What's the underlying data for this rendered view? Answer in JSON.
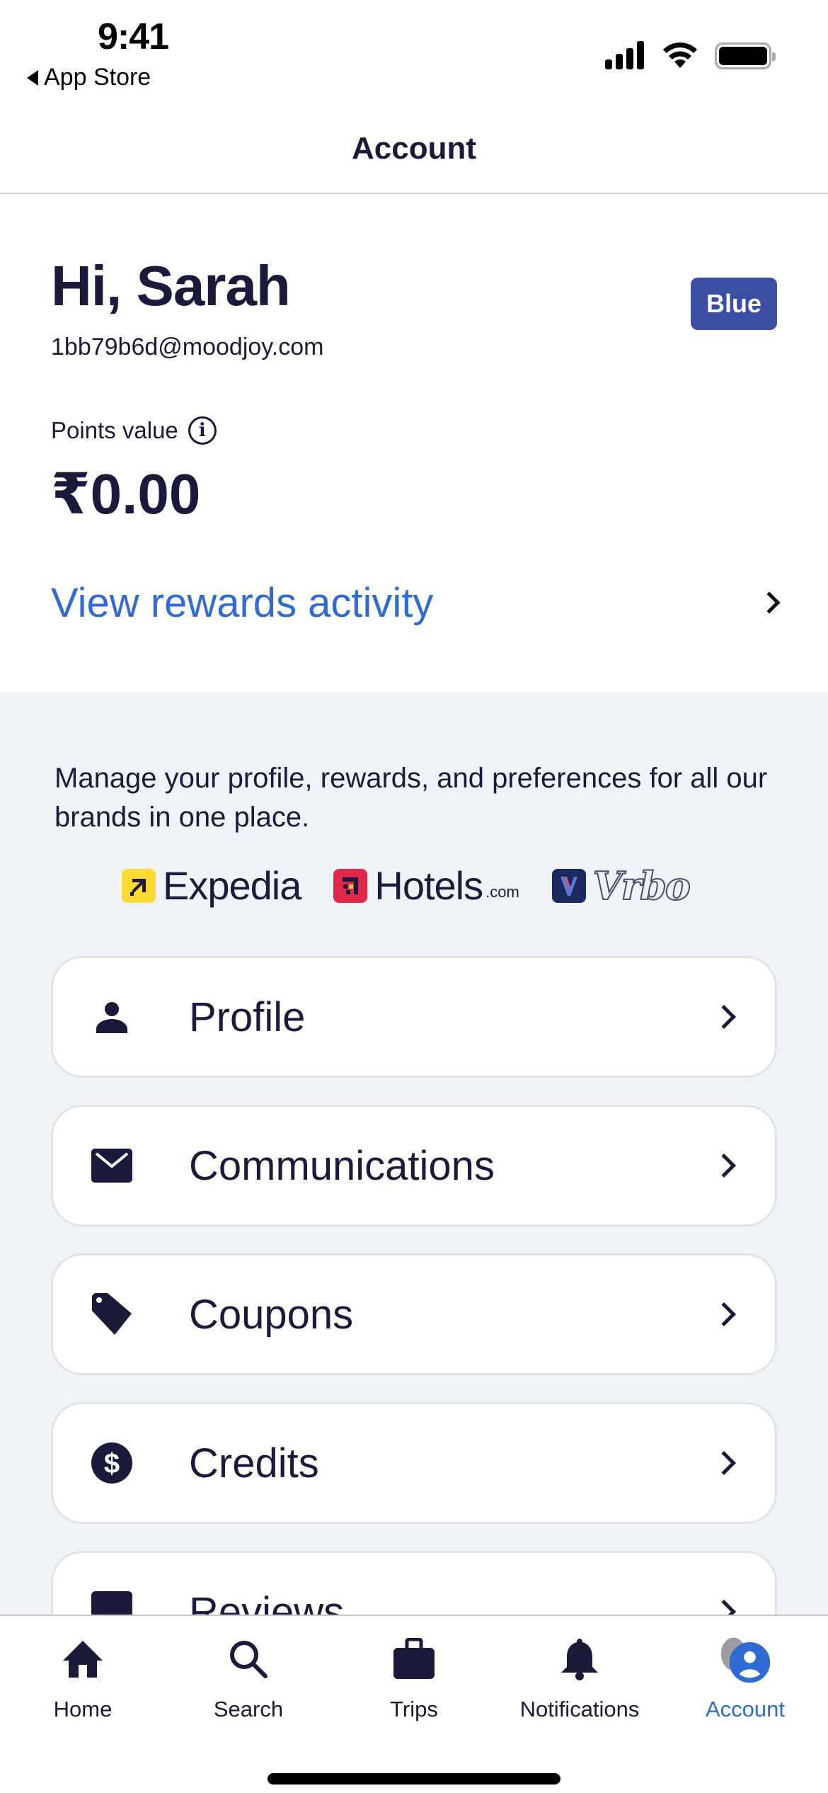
{
  "status_bar": {
    "time": "9:41",
    "back_app": "App Store"
  },
  "header": {
    "title": "Account"
  },
  "summary": {
    "greeting": "Hi, Sarah",
    "email": "1bb79b6d@moodjoy.com",
    "tier_badge": "Blue",
    "points_label": "Points value",
    "points_value": "₹0.00",
    "rewards_link": "View rewards activity"
  },
  "manage": {
    "description": "Manage your profile, rewards, and preferences for all our brands in one place.",
    "brands": [
      {
        "name": "Expedia",
        "suffix": "",
        "color": "#fddb32"
      },
      {
        "name": "Hotels",
        "suffix": ".com",
        "color": "#e0284a"
      },
      {
        "name": "Vrbo",
        "suffix": "",
        "color": "#1b2a5e"
      }
    ]
  },
  "menu": [
    {
      "label": "Profile",
      "icon": "person-icon"
    },
    {
      "label": "Communications",
      "icon": "envelope-icon"
    },
    {
      "label": "Coupons",
      "icon": "tag-icon"
    },
    {
      "label": "Credits",
      "icon": "dollar-circle-icon"
    },
    {
      "label": "Reviews",
      "icon": "reviews-icon"
    }
  ],
  "tab_bar": {
    "tabs": [
      {
        "label": "Home",
        "icon": "home-icon",
        "active": false
      },
      {
        "label": "Search",
        "icon": "search-icon",
        "active": false
      },
      {
        "label": "Trips",
        "icon": "suitcase-icon",
        "active": false
      },
      {
        "label": "Notifications",
        "icon": "bell-icon",
        "active": false
      },
      {
        "label": "Account",
        "icon": "account-icon",
        "active": true
      }
    ]
  },
  "colors": {
    "primary_text": "#1b1a3a",
    "link_blue": "#2f6bd2",
    "badge_blue": "#3b4ea3",
    "section_bg": "#eff2f7"
  }
}
